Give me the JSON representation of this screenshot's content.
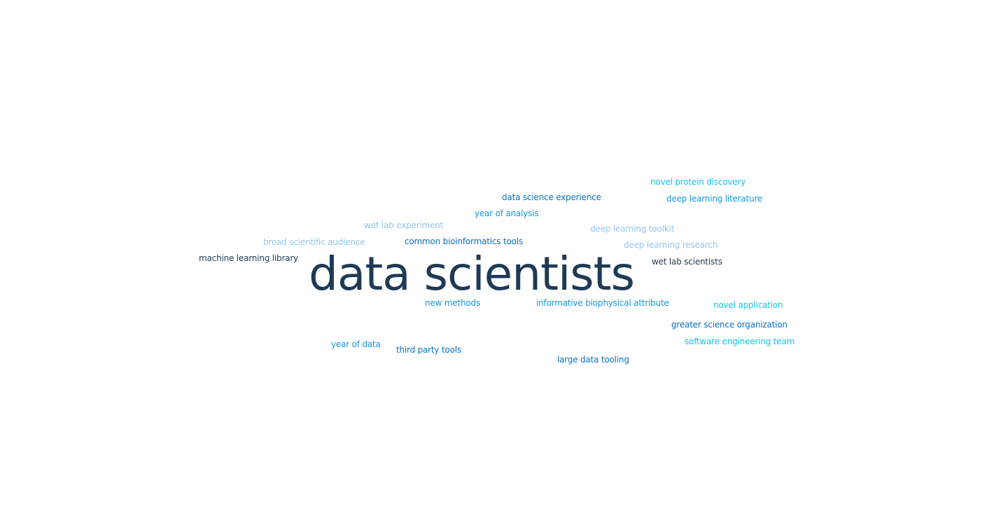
{
  "terms": {
    "novel_protein_discovery": "novel protein discovery",
    "data_science_experience": "data science experience",
    "deep_learning_literature": "deep learning literature",
    "year_of_analysis": "year of analysis",
    "wet_lab_experiment": "wet lab experiment",
    "deep_learning_toolkit": "deep learning toolkit",
    "broad_scientific_audience": "broad scientific audience",
    "common_bioinformatics_tools": "common bioinformatics tools",
    "deep_learning_research": "deep learning research",
    "machine_learning_library": "machine learning library",
    "wet_lab_scientists": "wet lab scientists",
    "data_scientists": "data scientists",
    "new_methods": "new methods",
    "informative_biophysical_attribute": "informative biophysical attribute",
    "novel_application": "novel application",
    "greater_science_organization": "greater science organization",
    "year_of_data": "year of data",
    "software_engineering_team": "software engineering team",
    "third_party_tools": "third party tools",
    "large_data_tooling": "large data tooling"
  },
  "colors": {
    "navy": "#1e3a56",
    "blue": "#0a6fc2",
    "mid_blue": "#1596de",
    "cyan": "#11c4ec",
    "light_blue": "#93c6ec",
    "background": "#ffffff"
  }
}
